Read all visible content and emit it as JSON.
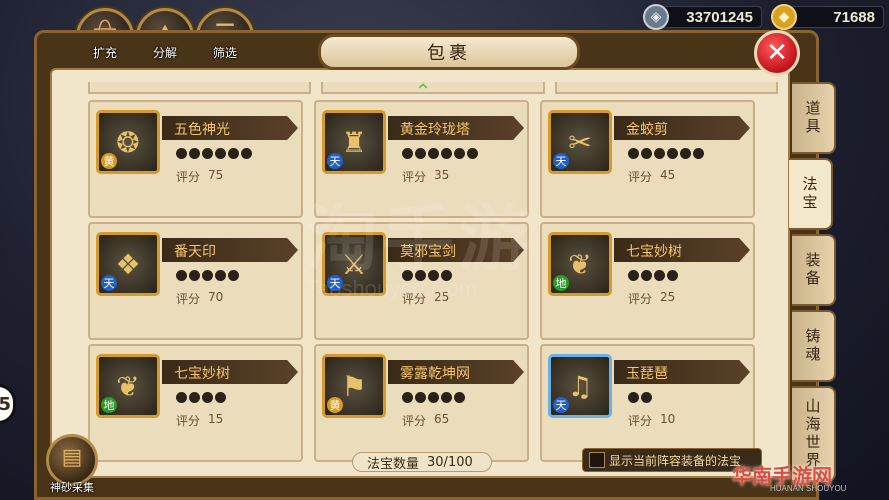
{
  "top_buttons": [
    {
      "label": "扩充",
      "icon": "bag-icon"
    },
    {
      "label": "分解",
      "icon": "decompose-icon"
    },
    {
      "label": "筛选",
      "icon": "filter-icon"
    }
  ],
  "currency": {
    "silver": "33701245",
    "gold": "71688"
  },
  "title": "包裹",
  "tabs": [
    {
      "label": "道具",
      "active": false
    },
    {
      "label": "法宝",
      "active": true
    },
    {
      "label": "装备",
      "active": false
    },
    {
      "label": "铸魂",
      "active": false
    },
    {
      "label": "山海世界",
      "active": false
    }
  ],
  "items": [
    {
      "name": "五色神光",
      "grade": "黄",
      "stars": 6,
      "score_label": "评分",
      "score": "75",
      "icon": "orb-icon",
      "frame": "gold"
    },
    {
      "name": "黄金玲珑塔",
      "grade": "天",
      "stars": 6,
      "score_label": "评分",
      "score": "35",
      "icon": "pagoda-icon",
      "frame": "gold"
    },
    {
      "name": "金蛟剪",
      "grade": "天",
      "stars": 6,
      "score_label": "评分",
      "score": "45",
      "icon": "scissors-icon",
      "frame": "gold"
    },
    {
      "name": "番天印",
      "grade": "天",
      "stars": 5,
      "score_label": "评分",
      "score": "70",
      "icon": "seal-icon",
      "frame": "gold"
    },
    {
      "name": "莫邪宝剑",
      "grade": "天",
      "stars": 4,
      "score_label": "评分",
      "score": "25",
      "icon": "sword-icon",
      "frame": "gold"
    },
    {
      "name": "七宝妙树",
      "grade": "地",
      "stars": 4,
      "score_label": "评分",
      "score": "25",
      "icon": "tree-icon",
      "frame": "gold"
    },
    {
      "name": "七宝妙树",
      "grade": "地",
      "stars": 4,
      "score_label": "评分",
      "score": "15",
      "icon": "tree-icon",
      "frame": "gold"
    },
    {
      "name": "雾露乾坤网",
      "grade": "黄",
      "stars": 5,
      "score_label": "评分",
      "score": "65",
      "icon": "net-icon",
      "frame": "gold"
    },
    {
      "name": "玉琵琶",
      "grade": "天",
      "stars": 2,
      "score_label": "评分",
      "score": "10",
      "icon": "pipa-icon",
      "frame": "blue"
    }
  ],
  "footer": {
    "count_label": "法宝数量",
    "count_value": "30/100",
    "show_equipped_label": "显示当前阵容装备的法宝",
    "sand_label": "神砂采集"
  },
  "watermark": {
    "line1": "淘手游",
    "line2": "Taoshouyou.Com"
  },
  "brand": {
    "name": "华南手游网",
    "sub": "HUANAN SHOUYOU"
  },
  "side_badge": "5"
}
